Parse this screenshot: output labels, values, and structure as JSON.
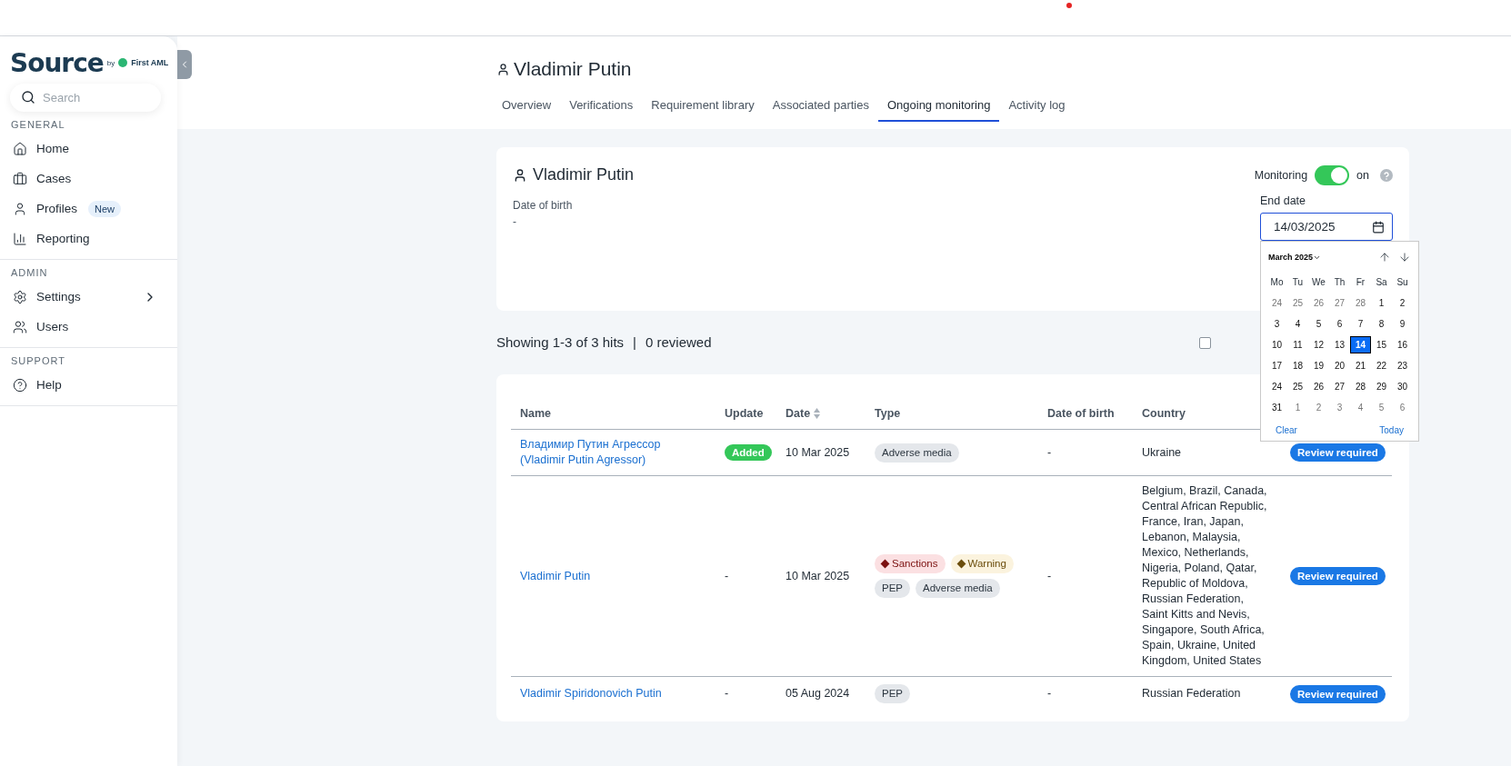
{
  "sidebar": {
    "logo": {
      "name": "Source",
      "by": "by",
      "partner": "First AML"
    },
    "search": {
      "placeholder": "Search"
    },
    "sections": [
      {
        "title": "GENERAL",
        "items": [
          {
            "label": "Home",
            "kind": "home",
            "has_submenu": false
          },
          {
            "label": "Cases",
            "kind": "briefcase",
            "has_submenu": false
          },
          {
            "label": "Profiles",
            "kind": "person",
            "badge": "New",
            "has_submenu": false
          },
          {
            "label": "Reporting",
            "kind": "chart",
            "has_submenu": false
          }
        ]
      },
      {
        "title": "ADMIN",
        "items": [
          {
            "label": "Settings",
            "kind": "gear",
            "has_submenu": true
          },
          {
            "label": "Users",
            "kind": "users",
            "has_submenu": false
          }
        ]
      },
      {
        "title": "SUPPORT",
        "items": [
          {
            "label": "Help",
            "kind": "help",
            "has_submenu": false
          }
        ]
      }
    ]
  },
  "header": {
    "title": "Vladimir Putin",
    "tabs": [
      {
        "label": "Overview",
        "selected": false
      },
      {
        "label": "Verifications",
        "selected": false
      },
      {
        "label": "Requirement library",
        "selected": false
      },
      {
        "label": "Associated parties",
        "selected": false
      },
      {
        "label": "Ongoing monitoring",
        "selected": true
      },
      {
        "label": "Activity log",
        "selected": false
      }
    ]
  },
  "profile_card": {
    "name": "Vladimir Putin",
    "fields": [
      {
        "label": "Date of birth",
        "value": "-"
      }
    ],
    "monitoring": {
      "label": "Monitoring",
      "on": true,
      "state_text": "on"
    },
    "end_date": {
      "label": "End date",
      "value": "14/03/2025"
    }
  },
  "date_picker": {
    "month": "March 2025",
    "weekdays": [
      "Mo",
      "Tu",
      "We",
      "Th",
      "Fr",
      "Sa",
      "Su"
    ],
    "days": [
      {
        "day": "24",
        "current_month": false,
        "selected": false
      },
      {
        "day": "25",
        "current_month": false,
        "selected": false
      },
      {
        "day": "26",
        "current_month": false,
        "selected": false
      },
      {
        "day": "27",
        "current_month": false,
        "selected": false
      },
      {
        "day": "28",
        "current_month": false,
        "selected": false
      },
      {
        "day": "1",
        "current_month": true,
        "selected": false
      },
      {
        "day": "2",
        "current_month": true,
        "selected": false
      },
      {
        "day": "3",
        "current_month": true,
        "selected": false
      },
      {
        "day": "4",
        "current_month": true,
        "selected": false
      },
      {
        "day": "5",
        "current_month": true,
        "selected": false
      },
      {
        "day": "6",
        "current_month": true,
        "selected": false
      },
      {
        "day": "7",
        "current_month": true,
        "selected": false
      },
      {
        "day": "8",
        "current_month": true,
        "selected": false
      },
      {
        "day": "9",
        "current_month": true,
        "selected": false
      },
      {
        "day": "10",
        "current_month": true,
        "selected": false
      },
      {
        "day": "11",
        "current_month": true,
        "selected": false
      },
      {
        "day": "12",
        "current_month": true,
        "selected": false
      },
      {
        "day": "13",
        "current_month": true,
        "selected": false
      },
      {
        "day": "14",
        "current_month": true,
        "selected": true
      },
      {
        "day": "15",
        "current_month": true,
        "selected": false
      },
      {
        "day": "16",
        "current_month": true,
        "selected": false
      },
      {
        "day": "17",
        "current_month": true,
        "selected": false
      },
      {
        "day": "18",
        "current_month": true,
        "selected": false
      },
      {
        "day": "19",
        "current_month": true,
        "selected": false
      },
      {
        "day": "20",
        "current_month": true,
        "selected": false
      },
      {
        "day": "21",
        "current_month": true,
        "selected": false
      },
      {
        "day": "22",
        "current_month": true,
        "selected": false
      },
      {
        "day": "23",
        "current_month": true,
        "selected": false
      },
      {
        "day": "24",
        "current_month": true,
        "selected": false
      },
      {
        "day": "25",
        "current_month": true,
        "selected": false
      },
      {
        "day": "26",
        "current_month": true,
        "selected": false
      },
      {
        "day": "27",
        "current_month": true,
        "selected": false
      },
      {
        "day": "28",
        "current_month": true,
        "selected": false
      },
      {
        "day": "29",
        "current_month": true,
        "selected": false
      },
      {
        "day": "30",
        "current_month": true,
        "selected": false
      },
      {
        "day": "31",
        "current_month": true,
        "selected": false
      },
      {
        "day": "1",
        "current_month": false,
        "selected": false
      },
      {
        "day": "2",
        "current_month": false,
        "selected": false
      },
      {
        "day": "3",
        "current_month": false,
        "selected": false
      },
      {
        "day": "4",
        "current_month": false,
        "selected": false
      },
      {
        "day": "5",
        "current_month": false,
        "selected": false
      },
      {
        "day": "6",
        "current_month": false,
        "selected": false
      }
    ],
    "clear": "Clear",
    "today": "Today"
  },
  "summary": {
    "hits": "Showing 1-3 of 3 hits",
    "separator": "|",
    "reviewed": "0 reviewed"
  },
  "filter_checkbox": {
    "checked": false
  },
  "table": {
    "columns": [
      {
        "label": "Name",
        "sortable": false
      },
      {
        "label": "Update",
        "sortable": false
      },
      {
        "label": "Date",
        "sortable": true
      },
      {
        "label": "Type",
        "sortable": false
      },
      {
        "label": "Date of birth",
        "sortable": false
      },
      {
        "label": "Country",
        "sortable": false
      }
    ],
    "rows": [
      {
        "name": "Владимир Путин Агрессор (Vladimir Putin Agressor)",
        "update": "Added",
        "update_badge": true,
        "date": "10 Mar 2025",
        "tags": [
          {
            "label": "Adverse media",
            "kind": "neutral"
          }
        ],
        "date_of_birth": "-",
        "country": "Ukraine",
        "action": "Review required"
      },
      {
        "name": "Vladimir Putin",
        "update": "-",
        "update_badge": false,
        "date": "10 Mar 2025",
        "tags": [
          {
            "label": "Sanctions",
            "kind": "sanctions"
          },
          {
            "label": "Warning",
            "kind": "warning"
          },
          {
            "label": "PEP",
            "kind": "neutral"
          },
          {
            "label": "Adverse media",
            "kind": "neutral"
          }
        ],
        "date_of_birth": "-",
        "country": "Belgium, Brazil, Canada, Central African Republic, France, Iran, Japan, Lebanon, Malaysia, Mexico, Netherlands, Nigeria, Poland, Qatar, Republic of Moldova, Russian Federation, Saint Kitts and Nevis, Singapore, South Africa, Spain, Ukraine, United Kingdom, United States",
        "action": "Review required"
      },
      {
        "name": "Vladimir Spiridonovich Putin",
        "update": "-",
        "update_badge": false,
        "date": "05 Aug 2024",
        "tags": [
          {
            "label": "PEP",
            "kind": "neutral"
          }
        ],
        "date_of_birth": "-",
        "country": "Russian Federation",
        "action": "Review required"
      }
    ]
  }
}
